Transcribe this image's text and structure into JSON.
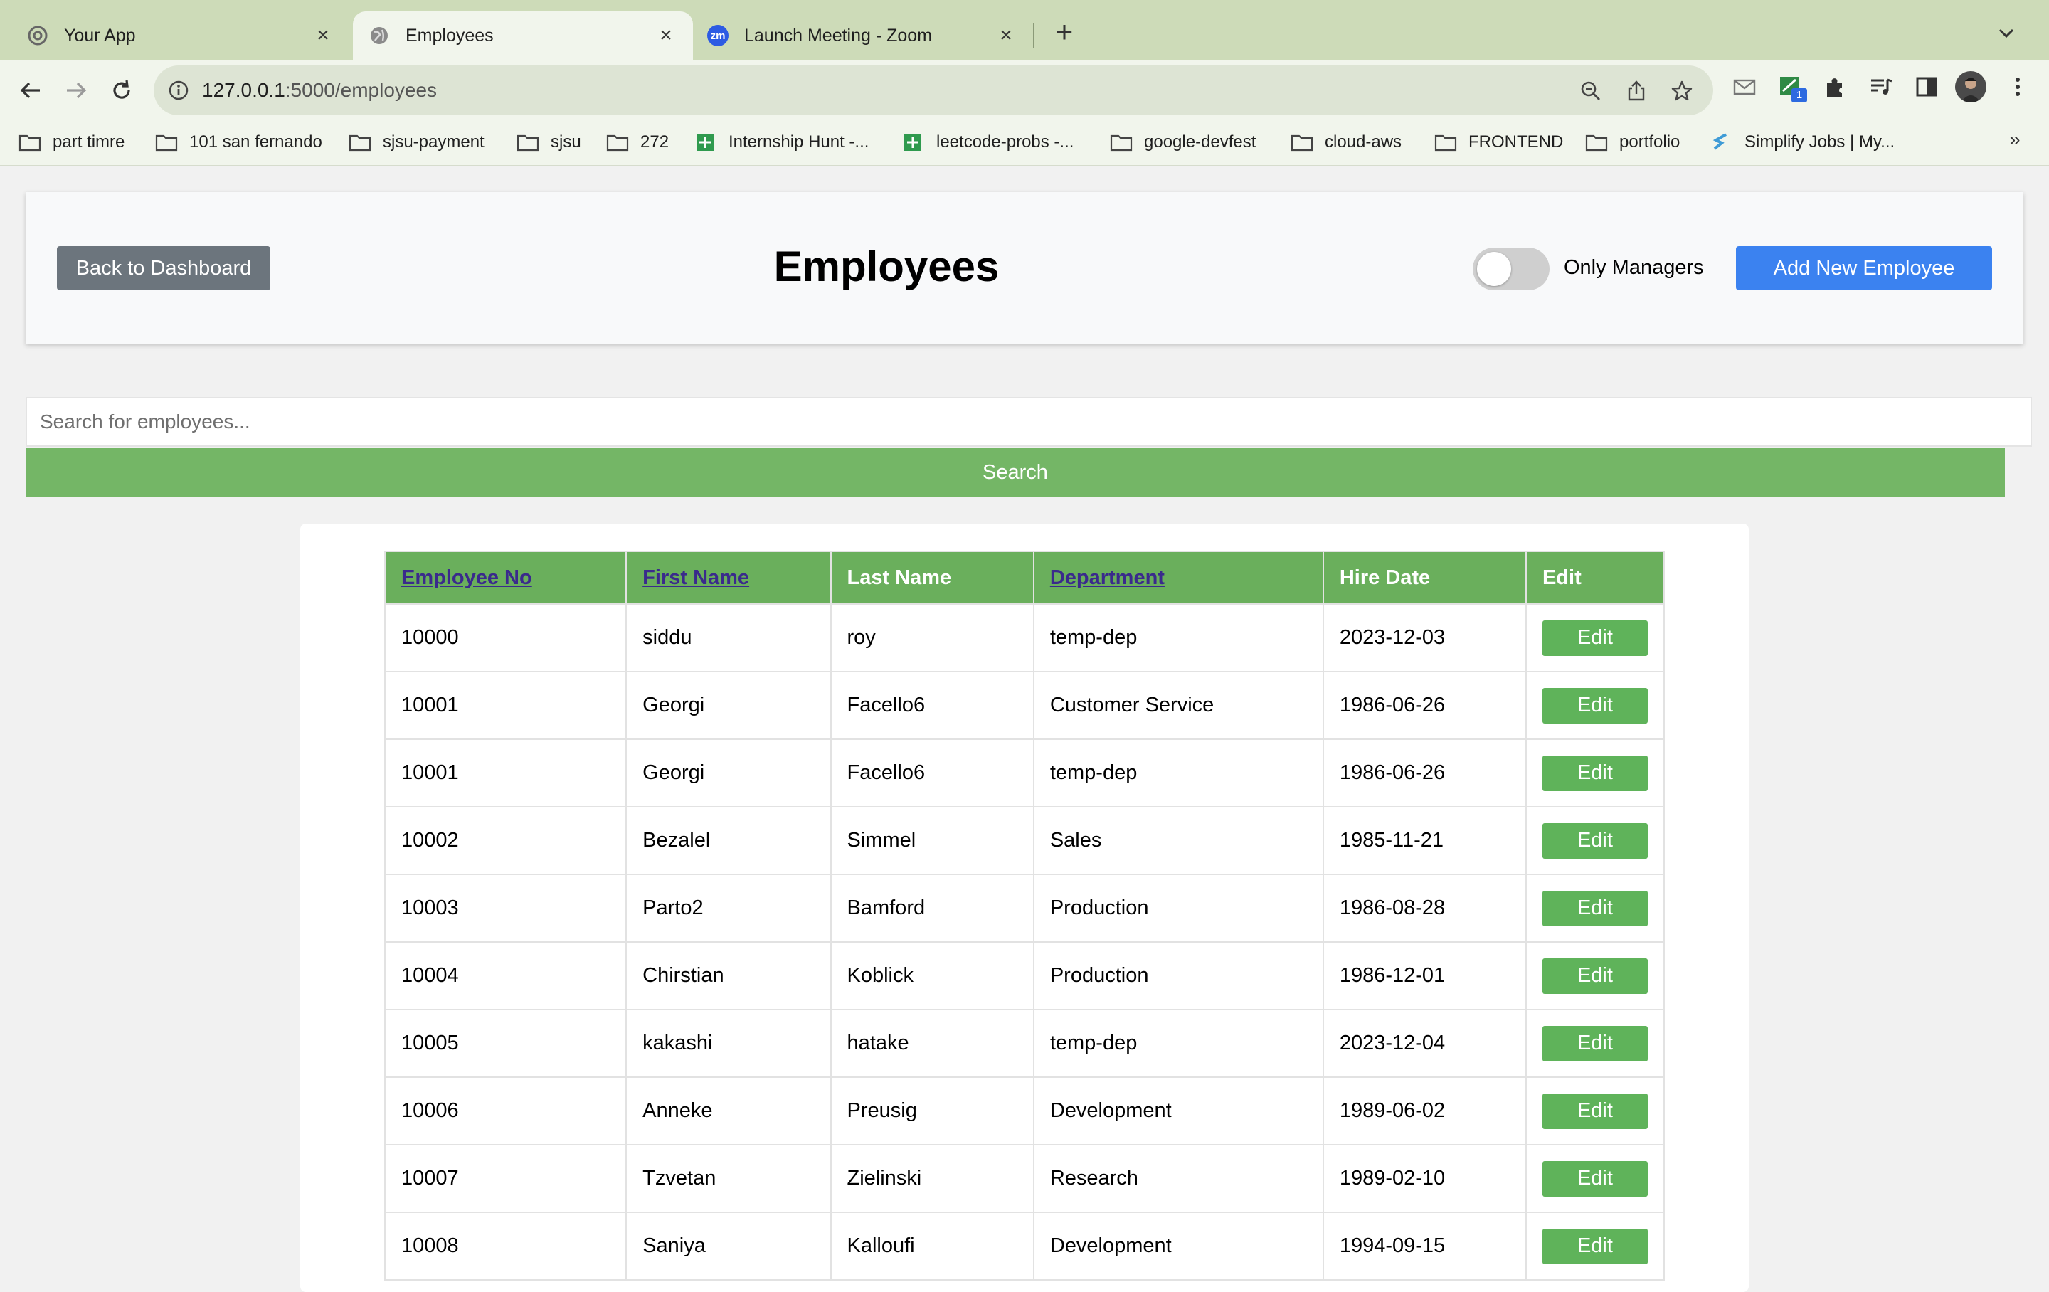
{
  "browser": {
    "tabs": [
      {
        "title": "Your App",
        "icon": "chrome-settings-icon",
        "active": false
      },
      {
        "title": "Employees",
        "icon": "globe-icon",
        "active": true
      },
      {
        "title": "Launch Meeting - Zoom",
        "icon": "zoom-icon",
        "active": false
      }
    ],
    "zoom_badge": "zm",
    "url_host": "127.0.0.1",
    "url_rest": ":5000/employees",
    "extension_badge": "1",
    "bookmarks": [
      {
        "label": "part timre",
        "icon": "folder-icon"
      },
      {
        "label": "101 san fernando",
        "icon": "folder-icon"
      },
      {
        "label": "sjsu-payment",
        "icon": "folder-icon"
      },
      {
        "label": "sjsu",
        "icon": "folder-icon"
      },
      {
        "label": "272",
        "icon": "folder-icon"
      },
      {
        "label": "Internship Hunt -...",
        "icon": "sheets-icon"
      },
      {
        "label": "leetcode-probs -...",
        "icon": "sheets-icon"
      },
      {
        "label": "google-devfest",
        "icon": "folder-icon"
      },
      {
        "label": "cloud-aws",
        "icon": "folder-icon"
      },
      {
        "label": "FRONTEND",
        "icon": "folder-icon"
      },
      {
        "label": "portfolio",
        "icon": "folder-icon"
      },
      {
        "label": "Simplify Jobs | My...",
        "icon": "simplify-icon"
      }
    ],
    "bookmarks_more": "»"
  },
  "header": {
    "back_label": "Back to Dashboard",
    "title": "Employees",
    "toggle_label": "Only Managers",
    "toggle_on": false,
    "add_label": "Add New Employee"
  },
  "search": {
    "placeholder": "Search for employees...",
    "value": "",
    "button_label": "Search"
  },
  "table": {
    "columns": [
      {
        "label": "Employee No",
        "sortable": true
      },
      {
        "label": "First Name",
        "sortable": true
      },
      {
        "label": "Last Name",
        "sortable": false
      },
      {
        "label": "Department",
        "sortable": true
      },
      {
        "label": "Hire Date",
        "sortable": false
      },
      {
        "label": "Edit",
        "sortable": false
      }
    ],
    "edit_label": "Edit",
    "rows": [
      [
        "10000",
        "siddu",
        "roy",
        "temp-dep",
        "2023-12-03"
      ],
      [
        "10001",
        "Georgi",
        "Facello6",
        "Customer Service",
        "1986-06-26"
      ],
      [
        "10001",
        "Georgi",
        "Facello6",
        "temp-dep",
        "1986-06-26"
      ],
      [
        "10002",
        "Bezalel",
        "Simmel",
        "Sales",
        "1985-11-21"
      ],
      [
        "10003",
        "Parto2",
        "Bamford",
        "Production",
        "1986-08-28"
      ],
      [
        "10004",
        "Chirstian",
        "Koblick",
        "Production",
        "1986-12-01"
      ],
      [
        "10005",
        "kakashi",
        "hatake",
        "temp-dep",
        "2023-12-04"
      ],
      [
        "10006",
        "Anneke",
        "Preusig",
        "Development",
        "1989-06-02"
      ],
      [
        "10007",
        "Tzvetan",
        "Zielinski",
        "Research",
        "1989-02-10"
      ],
      [
        "10008",
        "Saniya",
        "Kalloufi",
        "Development",
        "1994-09-15"
      ]
    ]
  },
  "colors": {
    "tabstrip": "#cddbb8",
    "header_green": "#6aaf5c",
    "search_green": "#74b666",
    "edit_green": "#5fb35a",
    "primary_blue": "#3b82f0",
    "secondary_gray": "#6c757d"
  }
}
